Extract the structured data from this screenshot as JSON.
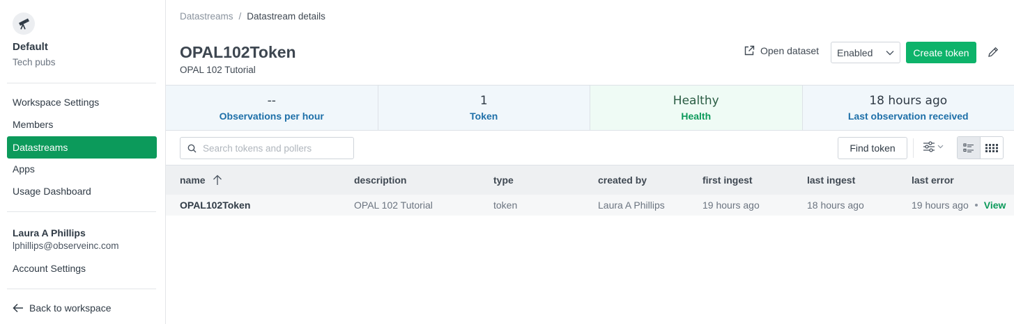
{
  "sidebar": {
    "workspace_name": "Default",
    "workspace_sub": "Tech pubs",
    "nav": [
      {
        "label": "Workspace Settings"
      },
      {
        "label": "Members"
      },
      {
        "label": "Datastreams"
      },
      {
        "label": "Apps"
      },
      {
        "label": "Usage Dashboard"
      }
    ],
    "user_name": "Laura A Phillips",
    "user_email": "lphillips@observeinc.com",
    "account_settings": "Account Settings",
    "back_link": "Back to workspace"
  },
  "breadcrumb": {
    "root": "Datastreams",
    "sep": "/",
    "current": "Datastream details"
  },
  "header": {
    "title": "OPAL102Token",
    "subtitle": "OPAL 102 Tutorial",
    "open_dataset": "Open dataset",
    "status_select": "Enabled",
    "create_token": "Create token"
  },
  "stats": [
    {
      "value": "--",
      "label": "Observations per hour"
    },
    {
      "value": "1",
      "label": "Token"
    },
    {
      "value": "Healthy",
      "label": "Health"
    },
    {
      "value": "18 hours ago",
      "label": "Last observation received"
    }
  ],
  "toolbar": {
    "search_placeholder": "Search tokens and pollers",
    "find_token": "Find token"
  },
  "table": {
    "headers": [
      "name",
      "description",
      "type",
      "created by",
      "first ingest",
      "last ingest",
      "last error"
    ],
    "rows": [
      [
        "OPAL102Token",
        "OPAL 102 Tutorial",
        "token",
        "Laura A Phillips",
        "19 hours ago",
        "18 hours ago",
        "19 hours ago"
      ]
    ],
    "row_action": "View"
  },
  "colors": {
    "accent": "#0db36a",
    "active_nav": "#0c9a5b",
    "stat_label": "#1d6fa8"
  }
}
